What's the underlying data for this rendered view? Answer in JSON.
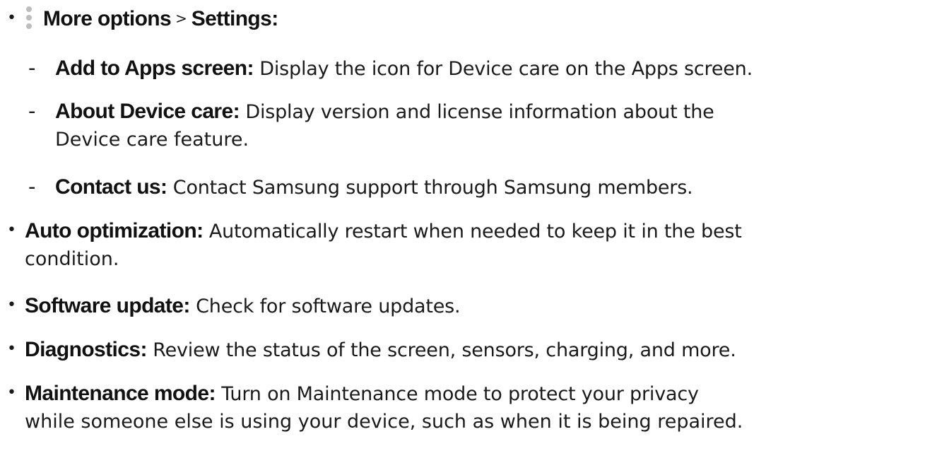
{
  "header_item": {
    "icon": "more-options-icon",
    "more_options": "More options",
    "separator": ">",
    "settings": "Settings:"
  },
  "sub_items": [
    {
      "term": "Add to Apps screen:",
      "desc": " Display the icon for Device care on the Apps screen."
    },
    {
      "term": "About Device care:",
      "desc": " Display version and license information about the",
      "cont": "Device care feature."
    },
    {
      "term": "Contact us:",
      "desc": " Contact Samsung support through Samsung members."
    }
  ],
  "items": [
    {
      "term": "Auto optimization:",
      "desc": " Automatically restart when needed to keep it in the best",
      "cont": "condition."
    },
    {
      "term": "Software update:",
      "desc": " Check for software updates."
    },
    {
      "term": "Diagnostics:",
      "desc": " Review the status of the screen, sensors, charging, and more."
    },
    {
      "term": "Maintenance mode:",
      "desc": " Turn on Maintenance mode to protect your privacy",
      "cont": "while someone else is using your device, such as when it is being repaired."
    }
  ],
  "symbols": {
    "bullet": "•",
    "dash": "-"
  }
}
